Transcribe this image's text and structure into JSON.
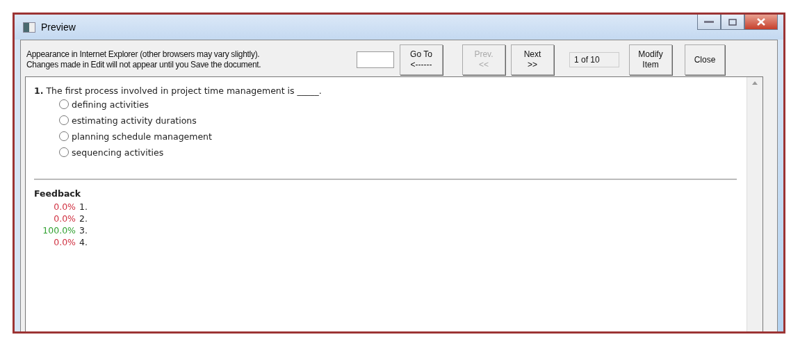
{
  "window": {
    "title": "Preview"
  },
  "notice": [
    "Appearance in Internet Explorer (other browsers may vary slightly).",
    "Changes made in Edit will not appear until you Save the document."
  ],
  "toolbar": [
    {
      "kind": "field"
    },
    {
      "kind": "button",
      "lines": [
        "Go To",
        "<------"
      ],
      "disabled": false
    },
    {
      "kind": "button",
      "lines": [
        "Prev.",
        "<<"
      ],
      "disabled": true
    },
    {
      "kind": "button",
      "lines": [
        "Next",
        ">>"
      ],
      "disabled": false
    },
    {
      "kind": "counter",
      "text": "1 of 10"
    },
    {
      "kind": "button",
      "lines": [
        "Modify",
        "Item"
      ],
      "disabled": false
    },
    {
      "kind": "close",
      "lines": [
        "Close"
      ],
      "disabled": false
    }
  ],
  "question": {
    "number": "1.",
    "text": "The first process involved in project time management is _____.",
    "options": [
      {
        "label": "defining activities",
        "checked": false
      },
      {
        "label": "estimating activity durations",
        "checked": false
      },
      {
        "label": "planning schedule management",
        "checked": false
      },
      {
        "label": "sequencing activities",
        "checked": false
      }
    ]
  },
  "feedback": {
    "title": "Feedback",
    "items": [
      {
        "percent": "0.0%",
        "option": "1.",
        "color": "#d03040"
      },
      {
        "percent": "0.0%",
        "option": "2.",
        "color": "#d03040"
      },
      {
        "percent": "100.0%",
        "option": "3.",
        "color": "#30a030"
      },
      {
        "percent": "0.0%",
        "option": "4.",
        "color": "#d03040"
      }
    ]
  }
}
